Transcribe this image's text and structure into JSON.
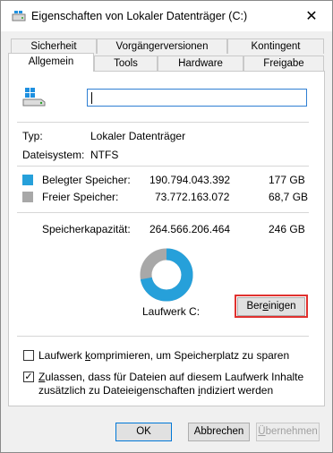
{
  "window": {
    "title": "Eigenschaften von Lokaler Datenträger (C:)",
    "close_glyph": "✕"
  },
  "tabs": {
    "row1": [
      "Sicherheit",
      "Vorgängerversionen",
      "Kontingent"
    ],
    "row2": [
      "Allgemein",
      "Tools",
      "Hardware",
      "Freigabe"
    ],
    "active": "Allgemein"
  },
  "general": {
    "name_value": "",
    "type_label": "Typ:",
    "type_value": "Lokaler Datenträger",
    "fs_label": "Dateisystem:",
    "fs_value": "NTFS",
    "used_label": "Belegter Speicher:",
    "used_bytes": "190.794.043.392",
    "used_size": "177 GB",
    "free_label": "Freier Speicher:",
    "free_bytes": "73.772.163.072",
    "free_size": "68,7 GB",
    "capacity_label": "Speicherkapazität:",
    "capacity_bytes": "264.566.206.464",
    "capacity_size": "246 GB",
    "drive_label": "Laufwerk C:",
    "cleanup_button": "Bereinigen",
    "used_fraction": 0.721
  },
  "options": {
    "compress_label": "Laufwerk komprimieren, um Speicherplatz zu sparen",
    "compress_checked": false,
    "index_label_line1": "Zulassen, dass für Dateien auf diesem Laufwerk Inhalte",
    "index_label_line2": "zusätzlich zu Dateieigenschaften indiziert werden",
    "index_checked": true,
    "check_glyph": "✓"
  },
  "buttons": {
    "ok": "OK",
    "cancel": "Abbrechen",
    "apply": "Übernehmen"
  },
  "colors": {
    "used": "#26a0da",
    "free": "#a8a8a8",
    "highlight": "#e0312f"
  },
  "icons": {
    "title": "drive-icon",
    "drive": "drive-icon"
  }
}
